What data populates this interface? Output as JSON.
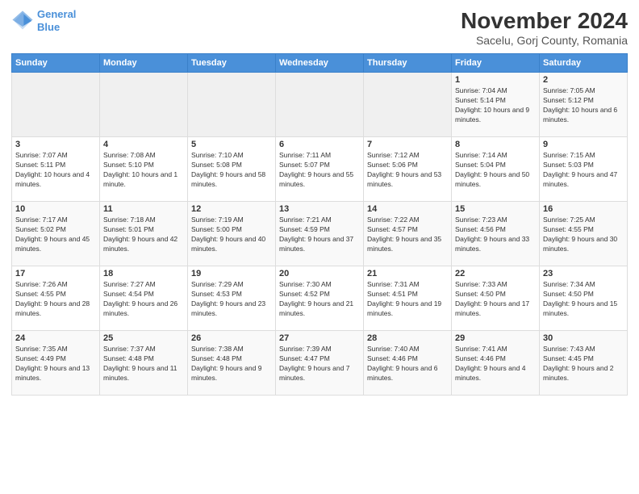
{
  "header": {
    "logo_line1": "General",
    "logo_line2": "Blue",
    "title": "November 2024",
    "subtitle": "Sacelu, Gorj County, Romania"
  },
  "days_of_week": [
    "Sunday",
    "Monday",
    "Tuesday",
    "Wednesday",
    "Thursday",
    "Friday",
    "Saturday"
  ],
  "weeks": [
    [
      {
        "day": "",
        "info": ""
      },
      {
        "day": "",
        "info": ""
      },
      {
        "day": "",
        "info": ""
      },
      {
        "day": "",
        "info": ""
      },
      {
        "day": "",
        "info": ""
      },
      {
        "day": "1",
        "info": "Sunrise: 7:04 AM\nSunset: 5:14 PM\nDaylight: 10 hours and 9 minutes."
      },
      {
        "day": "2",
        "info": "Sunrise: 7:05 AM\nSunset: 5:12 PM\nDaylight: 10 hours and 6 minutes."
      }
    ],
    [
      {
        "day": "3",
        "info": "Sunrise: 7:07 AM\nSunset: 5:11 PM\nDaylight: 10 hours and 4 minutes."
      },
      {
        "day": "4",
        "info": "Sunrise: 7:08 AM\nSunset: 5:10 PM\nDaylight: 10 hours and 1 minute."
      },
      {
        "day": "5",
        "info": "Sunrise: 7:10 AM\nSunset: 5:08 PM\nDaylight: 9 hours and 58 minutes."
      },
      {
        "day": "6",
        "info": "Sunrise: 7:11 AM\nSunset: 5:07 PM\nDaylight: 9 hours and 55 minutes."
      },
      {
        "day": "7",
        "info": "Sunrise: 7:12 AM\nSunset: 5:06 PM\nDaylight: 9 hours and 53 minutes."
      },
      {
        "day": "8",
        "info": "Sunrise: 7:14 AM\nSunset: 5:04 PM\nDaylight: 9 hours and 50 minutes."
      },
      {
        "day": "9",
        "info": "Sunrise: 7:15 AM\nSunset: 5:03 PM\nDaylight: 9 hours and 47 minutes."
      }
    ],
    [
      {
        "day": "10",
        "info": "Sunrise: 7:17 AM\nSunset: 5:02 PM\nDaylight: 9 hours and 45 minutes."
      },
      {
        "day": "11",
        "info": "Sunrise: 7:18 AM\nSunset: 5:01 PM\nDaylight: 9 hours and 42 minutes."
      },
      {
        "day": "12",
        "info": "Sunrise: 7:19 AM\nSunset: 5:00 PM\nDaylight: 9 hours and 40 minutes."
      },
      {
        "day": "13",
        "info": "Sunrise: 7:21 AM\nSunset: 4:59 PM\nDaylight: 9 hours and 37 minutes."
      },
      {
        "day": "14",
        "info": "Sunrise: 7:22 AM\nSunset: 4:57 PM\nDaylight: 9 hours and 35 minutes."
      },
      {
        "day": "15",
        "info": "Sunrise: 7:23 AM\nSunset: 4:56 PM\nDaylight: 9 hours and 33 minutes."
      },
      {
        "day": "16",
        "info": "Sunrise: 7:25 AM\nSunset: 4:55 PM\nDaylight: 9 hours and 30 minutes."
      }
    ],
    [
      {
        "day": "17",
        "info": "Sunrise: 7:26 AM\nSunset: 4:55 PM\nDaylight: 9 hours and 28 minutes."
      },
      {
        "day": "18",
        "info": "Sunrise: 7:27 AM\nSunset: 4:54 PM\nDaylight: 9 hours and 26 minutes."
      },
      {
        "day": "19",
        "info": "Sunrise: 7:29 AM\nSunset: 4:53 PM\nDaylight: 9 hours and 23 minutes."
      },
      {
        "day": "20",
        "info": "Sunrise: 7:30 AM\nSunset: 4:52 PM\nDaylight: 9 hours and 21 minutes."
      },
      {
        "day": "21",
        "info": "Sunrise: 7:31 AM\nSunset: 4:51 PM\nDaylight: 9 hours and 19 minutes."
      },
      {
        "day": "22",
        "info": "Sunrise: 7:33 AM\nSunset: 4:50 PM\nDaylight: 9 hours and 17 minutes."
      },
      {
        "day": "23",
        "info": "Sunrise: 7:34 AM\nSunset: 4:50 PM\nDaylight: 9 hours and 15 minutes."
      }
    ],
    [
      {
        "day": "24",
        "info": "Sunrise: 7:35 AM\nSunset: 4:49 PM\nDaylight: 9 hours and 13 minutes."
      },
      {
        "day": "25",
        "info": "Sunrise: 7:37 AM\nSunset: 4:48 PM\nDaylight: 9 hours and 11 minutes."
      },
      {
        "day": "26",
        "info": "Sunrise: 7:38 AM\nSunset: 4:48 PM\nDaylight: 9 hours and 9 minutes."
      },
      {
        "day": "27",
        "info": "Sunrise: 7:39 AM\nSunset: 4:47 PM\nDaylight: 9 hours and 7 minutes."
      },
      {
        "day": "28",
        "info": "Sunrise: 7:40 AM\nSunset: 4:46 PM\nDaylight: 9 hours and 6 minutes."
      },
      {
        "day": "29",
        "info": "Sunrise: 7:41 AM\nSunset: 4:46 PM\nDaylight: 9 hours and 4 minutes."
      },
      {
        "day": "30",
        "info": "Sunrise: 7:43 AM\nSunset: 4:45 PM\nDaylight: 9 hours and 2 minutes."
      }
    ]
  ]
}
